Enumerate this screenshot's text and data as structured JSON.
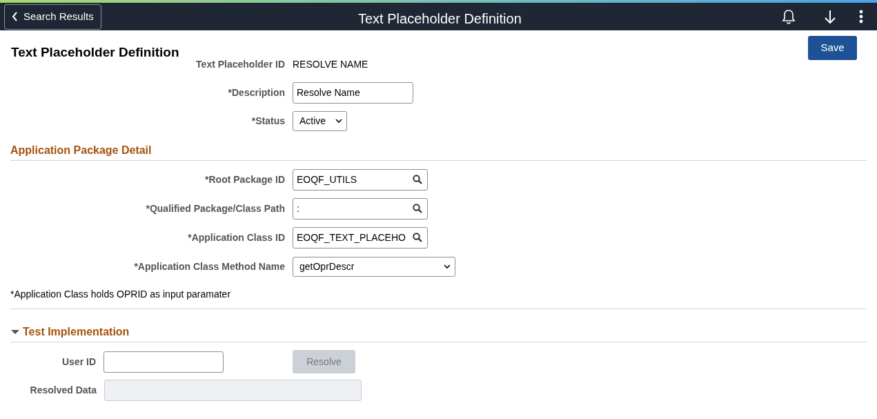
{
  "header": {
    "back_button": "Search Results",
    "title": "Text Placeholder Definition"
  },
  "page": {
    "title": "Text Placeholder Definition",
    "save_button": "Save"
  },
  "fields": [
    {
      "kind": "readonly",
      "label": "Text Placeholder ID",
      "value": "RESOLVE NAME"
    },
    {
      "kind": "text",
      "label": "*Description",
      "value": "Resolve Name"
    },
    {
      "kind": "select",
      "label": "*Status",
      "value": "Active"
    }
  ],
  "application_package_detail": {
    "title": "Application Package Detail",
    "fields": [
      {
        "kind": "lookup",
        "label": "*Root Package ID",
        "value": "EOQF_UTILS"
      },
      {
        "kind": "lookup",
        "label": "*Qualified Package/Class Path",
        "value": ":"
      },
      {
        "kind": "lookup",
        "label": "*Application Class ID",
        "value": "EOQF_TEXT_PLACEHO"
      },
      {
        "kind": "select",
        "label": "*Application Class Method Name",
        "value": "getOprDescr"
      }
    ],
    "note": "*Application Class holds OPRID as input paramater"
  },
  "test_implementation": {
    "title": "Test Implementation",
    "expanded": true,
    "user_id": {
      "label": "User ID"
    },
    "resolve_button": {
      "label": "Resolve",
      "disabled": true
    },
    "resolved_data": {
      "label": "Resolved Data",
      "disabled": true
    }
  }
}
